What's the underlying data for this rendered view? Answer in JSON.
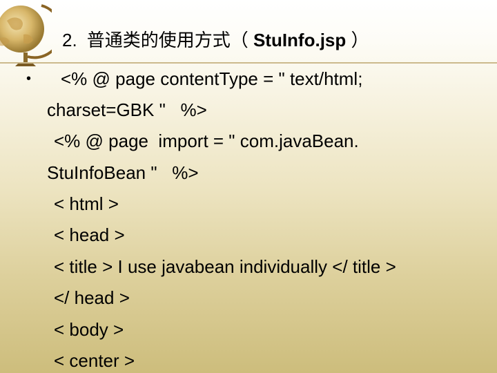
{
  "title": {
    "number": "2.",
    "chinese": "普通类的使用方式（",
    "filename": "StuInfo.jsp",
    "close_paren": "）"
  },
  "bullet_symbol": "•",
  "code_lines": [
    "<% @ page contentType = \" text/html;",
    "charset=GBK \"   %>",
    "<% @ page  import = \" com.javaBean.",
    "StuInfoBean \"   %>",
    "< html >",
    "< head >",
    "< title > I use javabean individually </ title >",
    "</ head >",
    "< body >",
    "< center >"
  ]
}
